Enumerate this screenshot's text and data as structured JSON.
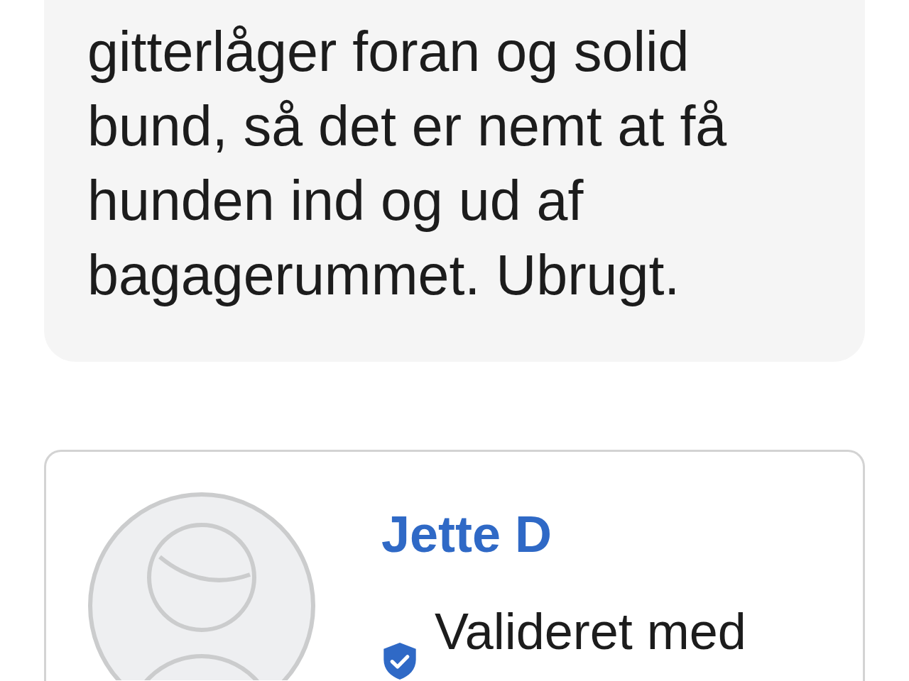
{
  "listing": {
    "description": "gitterlåger foran og solid bund, så det er nemt at få hunden ind og ud af bagagerummet. Ubrugt."
  },
  "seller": {
    "name": "Jette D",
    "verification": {
      "label": "Valideret med"
    }
  }
}
